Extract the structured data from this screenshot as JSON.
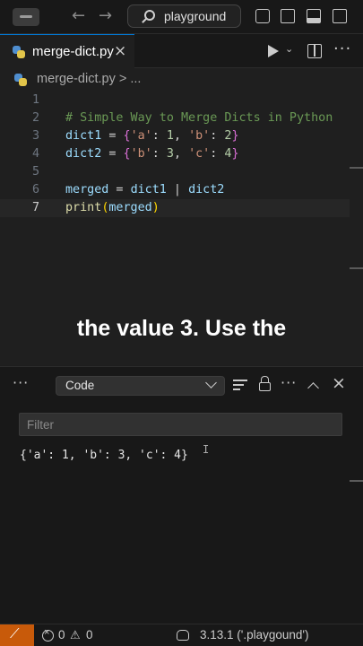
{
  "titlebar": {
    "search_text": "playground",
    "back_arrow": "←",
    "forward_arrow": "→"
  },
  "tab": {
    "label": "merge-dict.py",
    "close": "×"
  },
  "breadcrumb": {
    "text": "merge-dict.py > ..."
  },
  "editor": {
    "line_numbers": [
      "1",
      "2",
      "3",
      "4",
      "5",
      "6",
      "7"
    ],
    "line2": "# Simple Way to Merge Dicts in Python",
    "line3": {
      "var": "dict1",
      "eq": " = ",
      "open": "{",
      "k1": "'a'",
      "c1": ": ",
      "v1": "1",
      "s1": ", ",
      "k2": "'b'",
      "c2": ": ",
      "v2": "2",
      "close": "}"
    },
    "line4": {
      "var": "dict2",
      "eq": " = ",
      "open": "{",
      "k1": "'b'",
      "c1": ": ",
      "v1": "3",
      "s1": ", ",
      "k2": "'c'",
      "c2": ": ",
      "v2": "4",
      "close": "}"
    },
    "line6": {
      "var": "merged",
      "eq": " = ",
      "a": "dict1",
      "op": " | ",
      "b": "dict2"
    },
    "line7": {
      "fn": "print",
      "open": "(",
      "arg": "merged",
      "close": ")"
    }
  },
  "caption": "the value 3. Use the",
  "panel": {
    "more": "···",
    "dropdown_value": "Code",
    "filter_placeholder": "Filter",
    "close": "×",
    "output": "{'a': 1, 'b': 3, 'c': 4}",
    "cursor": "I"
  },
  "statusbar": {
    "remote_icon": "⟋",
    "errors": "0",
    "warning_icon": "⚠",
    "warnings": "0",
    "python_version": "3.13.1 ('.playgound')"
  },
  "colors": {
    "accent": "#0078d4",
    "remote_bg": "#c85a0a",
    "editor_bg": "#1f1f1f"
  }
}
